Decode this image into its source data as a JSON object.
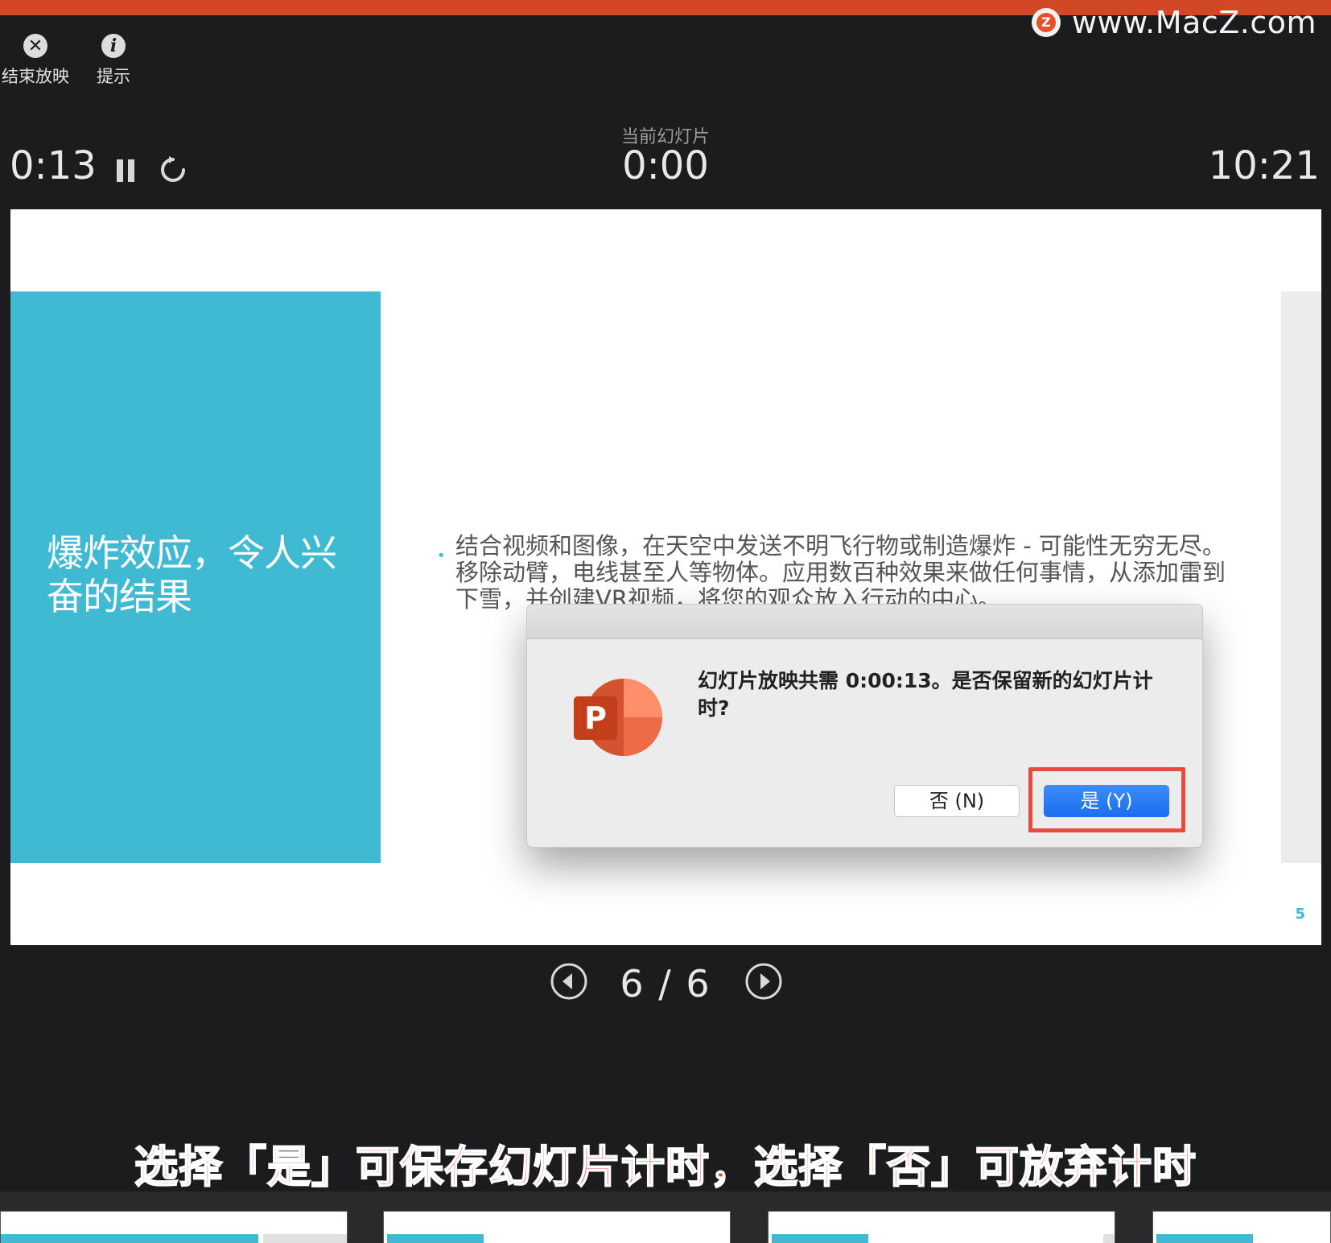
{
  "watermark": {
    "logo_letter": "Z",
    "text": "www.MacZ.com"
  },
  "toolbar": {
    "end_show": {
      "icon": "close-circle-icon",
      "label": "结束放映"
    },
    "hint": {
      "icon": "info-icon",
      "label": "提示"
    }
  },
  "timer": {
    "elapsed": "0:13",
    "current_slide_label": "当前幻灯片",
    "current_slide_time": "0:00",
    "clock": "10:21"
  },
  "slide": {
    "title": "爆炸效应，令人兴奋的结果",
    "bullet": "结合视频和图像，在天空中发送不明飞行物或制造爆炸 - 可能性无穷无尽。移除动臂，电线甚至人等物体。应用数百种效果来做任何事情，从添加雷到下雪，并创建VR视频，将您的观众放入行动的中心。",
    "page_number": "5"
  },
  "dialog": {
    "message": "幻灯片放映共需 0:00:13。是否保留新的幻灯片计时?",
    "no_label": "否 (N)",
    "yes_label": "是 (Y)",
    "app_icon_letter": "P"
  },
  "nav": {
    "counter": "6 / 6"
  },
  "caption": "选择「是」可保存幻灯片计时，选择「否」可放弃计时",
  "colors": {
    "accent": "#d24726",
    "teal": "#3fbad2",
    "primary_button": "#1a6ef0",
    "highlight": "#e84a3d"
  }
}
